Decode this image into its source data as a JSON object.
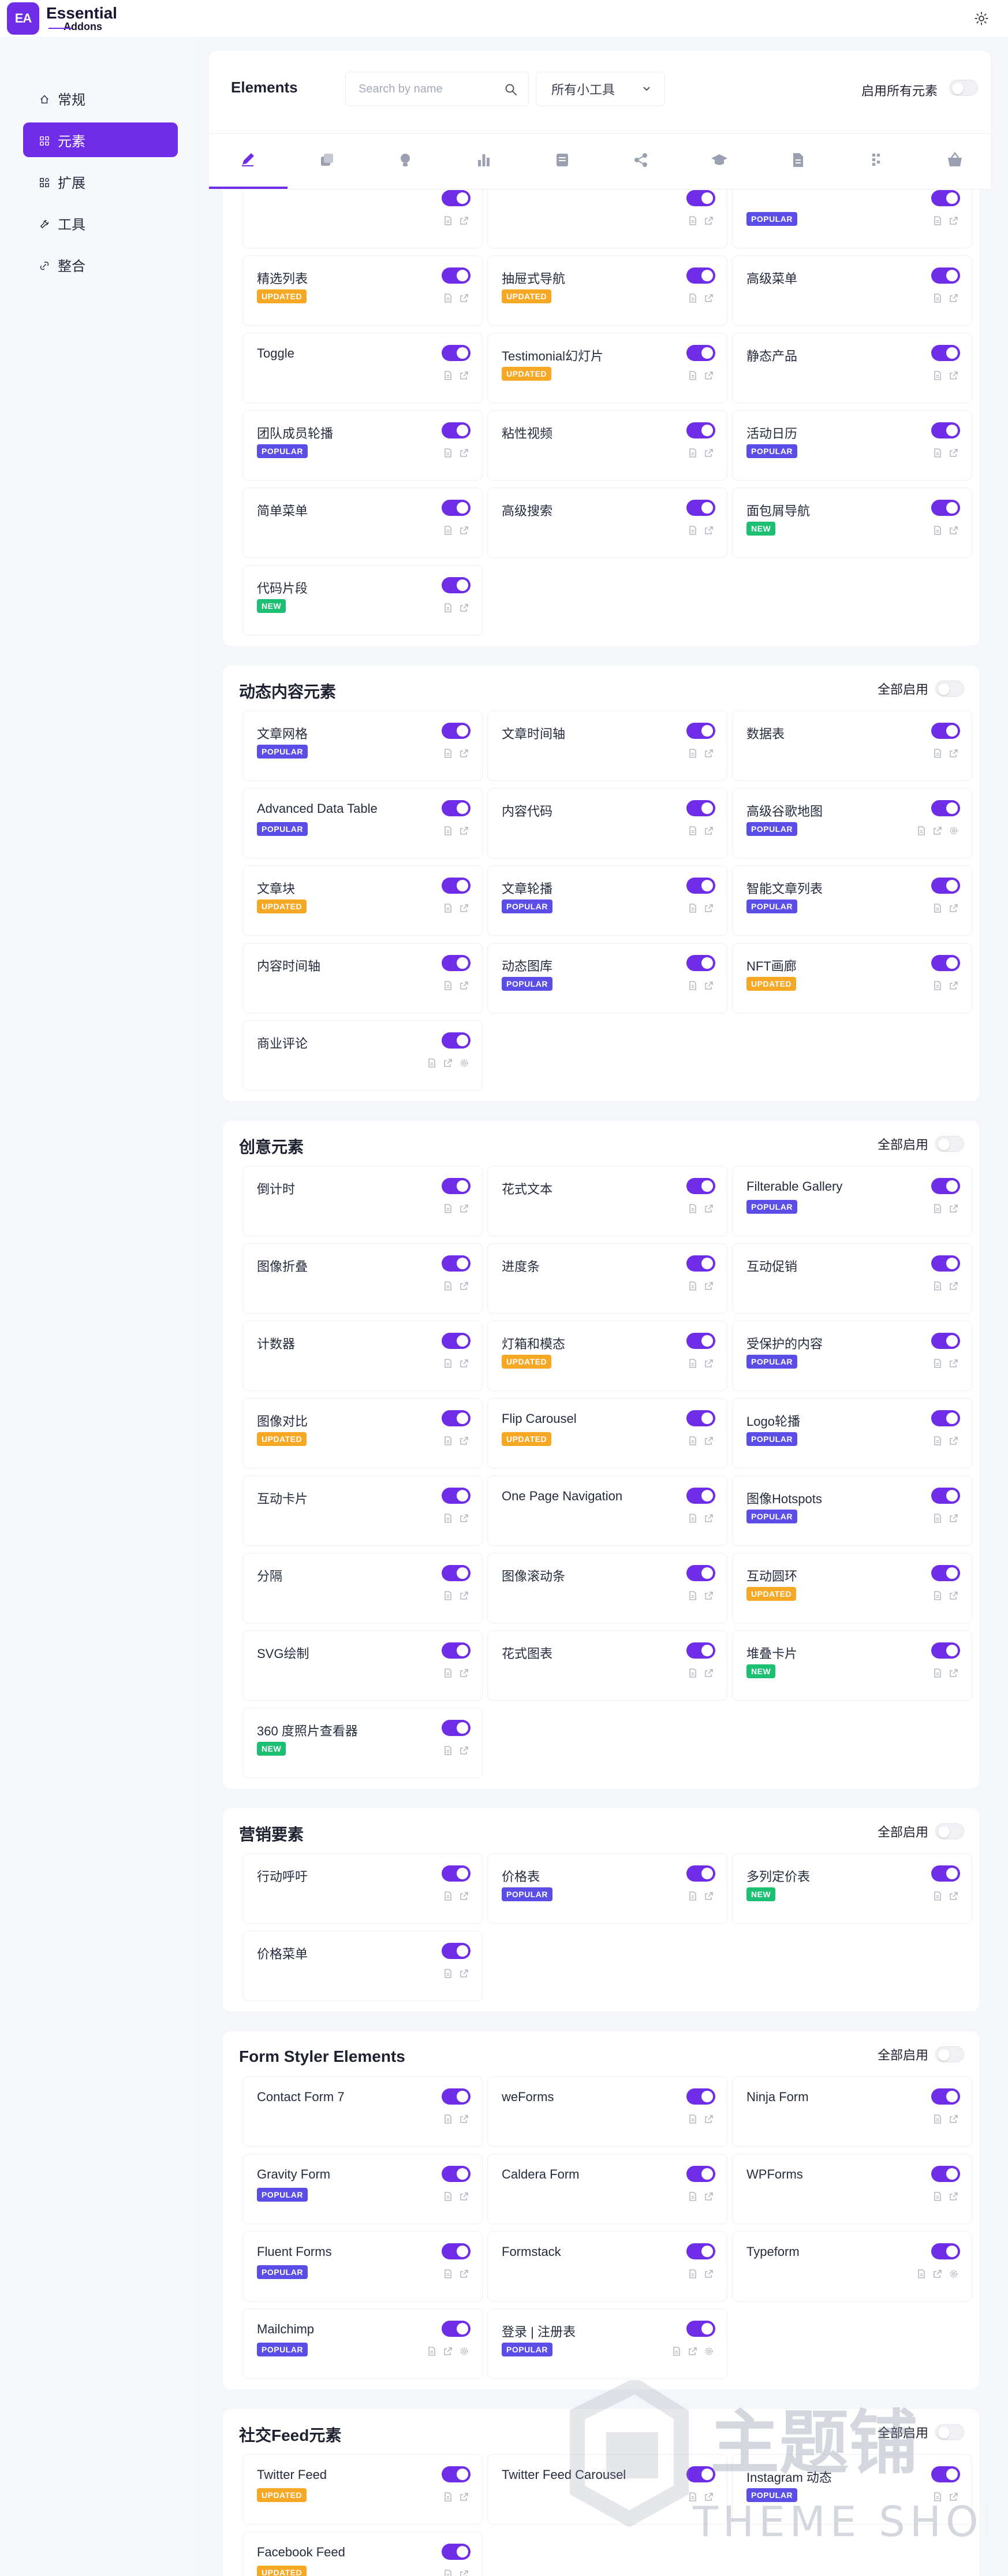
{
  "app": {
    "logo_mark": "EA",
    "logo_line1": "Essential",
    "logo_line2": "Addons"
  },
  "sidebar": {
    "items": [
      {
        "label": "常规",
        "icon": "home-icon",
        "active": false
      },
      {
        "label": "元素",
        "icon": "grid-icon",
        "active": true
      },
      {
        "label": "扩展",
        "icon": "extensions-icon",
        "active": false
      },
      {
        "label": "工具",
        "icon": "tools-icon",
        "active": false
      },
      {
        "label": "整合",
        "icon": "integration-icon",
        "active": false
      }
    ]
  },
  "header": {
    "title": "Elements",
    "search_placeholder": "Search by name",
    "filter_selected": "所有小工具",
    "enable_all_label": "启用所有元素"
  },
  "tabs": [
    {
      "icon": "pen-icon",
      "active": true
    },
    {
      "icon": "layers-icon",
      "active": false
    },
    {
      "icon": "lightbulb-icon",
      "active": false
    },
    {
      "icon": "bar-chart-icon",
      "active": false
    },
    {
      "icon": "form-icon",
      "active": false
    },
    {
      "icon": "share-icon",
      "active": false
    },
    {
      "icon": "graduation-cap-icon",
      "active": false
    },
    {
      "icon": "document-icon",
      "active": false
    },
    {
      "icon": "pattern-icon",
      "active": false
    },
    {
      "icon": "shopping-basket-icon",
      "active": false
    }
  ],
  "colors": {
    "accent": "#6f2de8",
    "popular": "#5b4ee6",
    "updated": "#f6a724",
    "new": "#1dbf73"
  },
  "sections": [
    {
      "title": "",
      "show_header": false,
      "cards": [
        {
          "name": "",
          "badge": "",
          "enabled": true,
          "icons": 2
        },
        {
          "name": "",
          "badge": "",
          "enabled": true,
          "icons": 2
        },
        {
          "name": "",
          "badge": "POPULAR",
          "enabled": true,
          "icons": 2
        },
        {
          "name": "精选列表",
          "badge": "UPDATED",
          "enabled": true,
          "icons": 2
        },
        {
          "name": "抽屉式导航",
          "badge": "UPDATED",
          "enabled": true,
          "icons": 2
        },
        {
          "name": "高级菜单",
          "badge": "",
          "enabled": true,
          "icons": 2
        },
        {
          "name": "Toggle",
          "badge": "",
          "enabled": true,
          "icons": 2
        },
        {
          "name": "Testimonial幻灯片",
          "badge": "UPDATED",
          "enabled": true,
          "icons": 2
        },
        {
          "name": "静态产品",
          "badge": "",
          "enabled": true,
          "icons": 2
        },
        {
          "name": "团队成员轮播",
          "badge": "POPULAR",
          "enabled": true,
          "icons": 2
        },
        {
          "name": "粘性视频",
          "badge": "",
          "enabled": true,
          "icons": 2
        },
        {
          "name": "活动日历",
          "badge": "POPULAR",
          "enabled": true,
          "icons": 2
        },
        {
          "name": "简单菜单",
          "badge": "",
          "enabled": true,
          "icons": 2
        },
        {
          "name": "高级搜索",
          "badge": "",
          "enabled": true,
          "icons": 2
        },
        {
          "name": "面包屑导航",
          "badge": "NEW",
          "enabled": true,
          "icons": 2
        },
        {
          "name": "代码片段",
          "badge": "NEW",
          "enabled": true,
          "icons": 2
        }
      ]
    },
    {
      "title": "动态内容元素",
      "show_header": true,
      "enable_label": "全部启用",
      "cards": [
        {
          "name": "文章网格",
          "badge": "POPULAR",
          "enabled": true,
          "icons": 2
        },
        {
          "name": "文章时间轴",
          "badge": "",
          "enabled": true,
          "icons": 2
        },
        {
          "name": "数据表",
          "badge": "",
          "enabled": true,
          "icons": 2
        },
        {
          "name": "Advanced Data Table",
          "badge": "POPULAR",
          "enabled": true,
          "icons": 2
        },
        {
          "name": "内容代码",
          "badge": "",
          "enabled": true,
          "icons": 2
        },
        {
          "name": "高级谷歌地图",
          "badge": "POPULAR",
          "enabled": true,
          "icons": 3
        },
        {
          "name": "文章块",
          "badge": "UPDATED",
          "enabled": true,
          "icons": 2
        },
        {
          "name": "文章轮播",
          "badge": "POPULAR",
          "enabled": true,
          "icons": 2
        },
        {
          "name": "智能文章列表",
          "badge": "POPULAR",
          "enabled": true,
          "icons": 2
        },
        {
          "name": "内容时间轴",
          "badge": "",
          "enabled": true,
          "icons": 2
        },
        {
          "name": "动态图库",
          "badge": "POPULAR",
          "enabled": true,
          "icons": 2
        },
        {
          "name": "NFT画廊",
          "badge": "UPDATED",
          "enabled": true,
          "icons": 2
        },
        {
          "name": "商业评论",
          "badge": "",
          "enabled": true,
          "icons": 3
        }
      ]
    },
    {
      "title": "创意元素",
      "show_header": true,
      "enable_label": "全部启用",
      "cards": [
        {
          "name": "倒计时",
          "badge": "",
          "enabled": true,
          "icons": 2
        },
        {
          "name": "花式文本",
          "badge": "",
          "enabled": true,
          "icons": 2
        },
        {
          "name": "Filterable Gallery",
          "badge": "POPULAR",
          "enabled": true,
          "icons": 2
        },
        {
          "name": "图像折叠",
          "badge": "",
          "enabled": true,
          "icons": 2
        },
        {
          "name": "进度条",
          "badge": "",
          "enabled": true,
          "icons": 2
        },
        {
          "name": "互动促销",
          "badge": "",
          "enabled": true,
          "icons": 2
        },
        {
          "name": "计数器",
          "badge": "",
          "enabled": true,
          "icons": 2
        },
        {
          "name": "灯箱和模态",
          "badge": "UPDATED",
          "enabled": true,
          "icons": 2
        },
        {
          "name": "受保护的内容",
          "badge": "POPULAR",
          "enabled": true,
          "icons": 2
        },
        {
          "name": "图像对比",
          "badge": "UPDATED",
          "enabled": true,
          "icons": 2
        },
        {
          "name": "Flip Carousel",
          "badge": "UPDATED",
          "enabled": true,
          "icons": 2
        },
        {
          "name": "Logo轮播",
          "badge": "POPULAR",
          "enabled": true,
          "icons": 2
        },
        {
          "name": "互动卡片",
          "badge": "",
          "enabled": true,
          "icons": 2
        },
        {
          "name": "One Page Navigation",
          "badge": "",
          "enabled": true,
          "icons": 2
        },
        {
          "name": "图像Hotspots",
          "badge": "POPULAR",
          "enabled": true,
          "icons": 2
        },
        {
          "name": "分隔",
          "badge": "",
          "enabled": true,
          "icons": 2
        },
        {
          "name": "图像滚动条",
          "badge": "",
          "enabled": true,
          "icons": 2
        },
        {
          "name": "互动圆环",
          "badge": "UPDATED",
          "enabled": true,
          "icons": 2
        },
        {
          "name": "SVG绘制",
          "badge": "",
          "enabled": true,
          "icons": 2
        },
        {
          "name": "花式图表",
          "badge": "",
          "enabled": true,
          "icons": 2
        },
        {
          "name": "堆叠卡片",
          "badge": "NEW",
          "enabled": true,
          "icons": 2
        },
        {
          "name": "360 度照片查看器",
          "badge": "NEW",
          "enabled": true,
          "icons": 2
        }
      ]
    },
    {
      "title": "营销要素",
      "show_header": true,
      "enable_label": "全部启用",
      "cards": [
        {
          "name": "行动呼吁",
          "badge": "",
          "enabled": true,
          "icons": 2
        },
        {
          "name": "价格表",
          "badge": "POPULAR",
          "enabled": true,
          "icons": 2
        },
        {
          "name": "多列定价表",
          "badge": "NEW",
          "enabled": true,
          "icons": 2
        },
        {
          "name": "价格菜单",
          "badge": "",
          "enabled": true,
          "icons": 2
        }
      ]
    },
    {
      "title": "Form Styler Elements",
      "show_header": true,
      "enable_label": "全部启用",
      "cards": [
        {
          "name": "Contact Form 7",
          "badge": "",
          "enabled": true,
          "icons": 2
        },
        {
          "name": "weForms",
          "badge": "",
          "enabled": true,
          "icons": 2
        },
        {
          "name": "Ninja Form",
          "badge": "",
          "enabled": true,
          "icons": 2
        },
        {
          "name": "Gravity Form",
          "badge": "POPULAR",
          "enabled": true,
          "icons": 2
        },
        {
          "name": "Caldera Form",
          "badge": "",
          "enabled": true,
          "icons": 2
        },
        {
          "name": "WPForms",
          "badge": "",
          "enabled": true,
          "icons": 2
        },
        {
          "name": "Fluent Forms",
          "badge": "POPULAR",
          "enabled": true,
          "icons": 2
        },
        {
          "name": "Formstack",
          "badge": "",
          "enabled": true,
          "icons": 2
        },
        {
          "name": "Typeform",
          "badge": "",
          "enabled": true,
          "icons": 3
        },
        {
          "name": "Mailchimp",
          "badge": "POPULAR",
          "enabled": true,
          "icons": 3
        },
        {
          "name": "登录 | 注册表",
          "badge": "POPULAR",
          "enabled": true,
          "icons": 3
        }
      ]
    },
    {
      "title": "社交Feed元素",
      "show_header": true,
      "enable_label": "全部启用",
      "cards": [
        {
          "name": "Twitter Feed",
          "badge": "UPDATED",
          "enabled": true,
          "icons": 2
        },
        {
          "name": "Twitter Feed Carousel",
          "badge": "",
          "enabled": true,
          "icons": 2
        },
        {
          "name": "Instagram 动态",
          "badge": "POPULAR",
          "enabled": true,
          "icons": 2
        },
        {
          "name": "Facebook Feed",
          "badge": "UPDATED",
          "enabled": true,
          "icons": 2
        }
      ]
    }
  ],
  "watermark": {
    "brand_cn": "主题铺",
    "brand_en": "THEME SHOP"
  }
}
